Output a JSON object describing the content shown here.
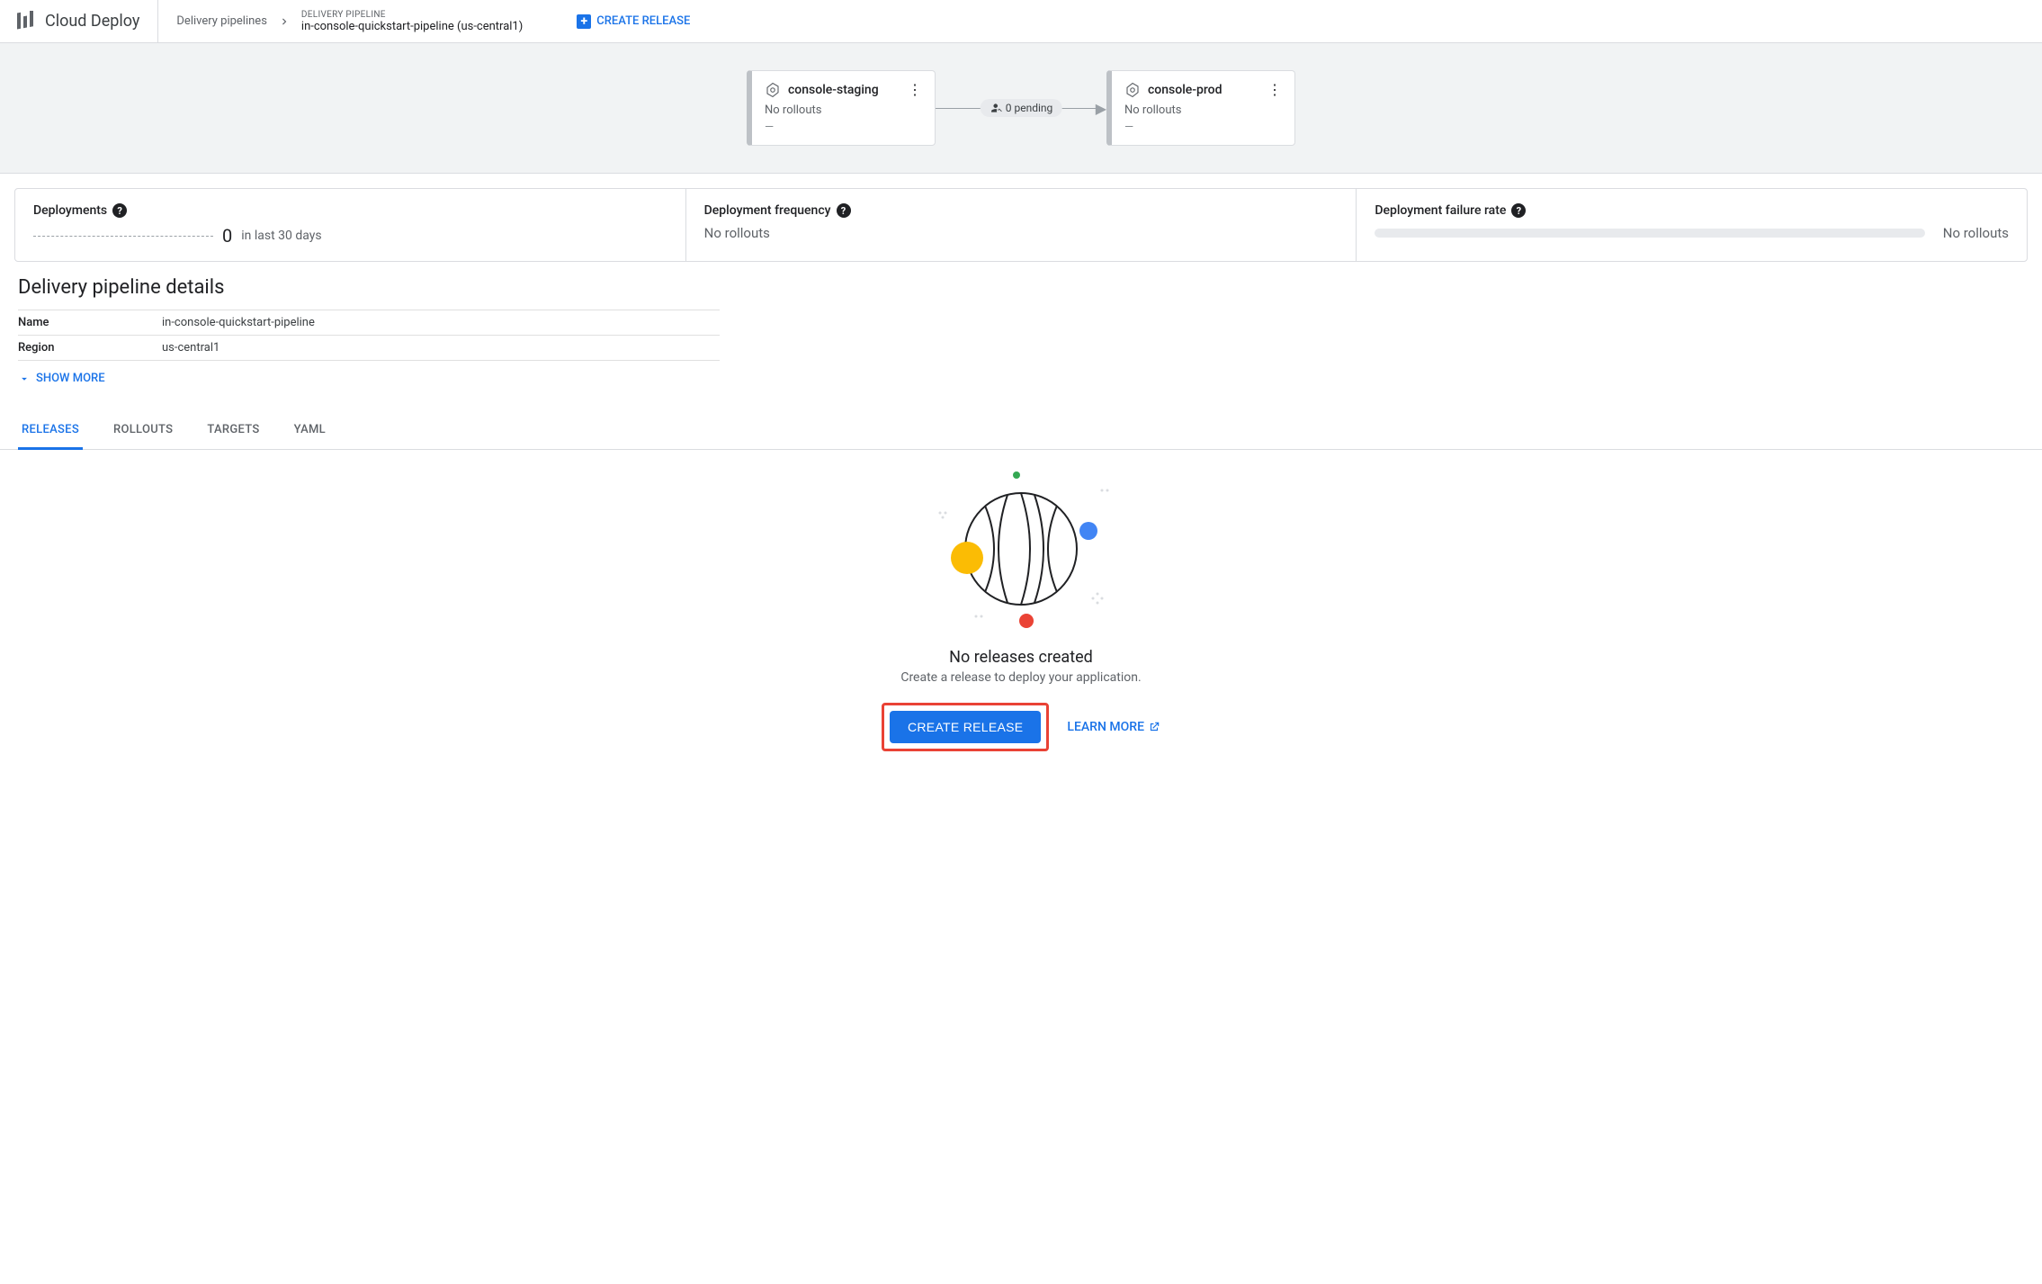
{
  "header": {
    "product": "Cloud Deploy",
    "breadcrumb_parent": "Delivery pipelines",
    "breadcrumb_label": "DELIVERY PIPELINE",
    "breadcrumb_value": "in-console-quickstart-pipeline (us-central1)",
    "create_release": "CREATE RELEASE"
  },
  "pipeline": {
    "stages": [
      {
        "name": "console-staging",
        "status": "No rollouts",
        "dash": "—"
      },
      {
        "name": "console-prod",
        "status": "No rollouts",
        "dash": "—"
      }
    ],
    "pending_badge": "0 pending"
  },
  "metrics": {
    "deployments": {
      "title": "Deployments",
      "count": "0",
      "suffix": "in last 30 days"
    },
    "frequency": {
      "title": "Deployment frequency",
      "value": "No rollouts"
    },
    "failure": {
      "title": "Deployment failure rate",
      "value": "No rollouts"
    }
  },
  "details": {
    "heading": "Delivery pipeline details",
    "rows": [
      {
        "key": "Name",
        "val": "in-console-quickstart-pipeline"
      },
      {
        "key": "Region",
        "val": "us-central1"
      }
    ],
    "show_more": "SHOW MORE"
  },
  "tabs": [
    "RELEASES",
    "ROLLOUTS",
    "TARGETS",
    "YAML"
  ],
  "empty": {
    "title": "No releases created",
    "sub": "Create a release to deploy your application.",
    "primary": "CREATE RELEASE",
    "secondary": "LEARN MORE"
  }
}
